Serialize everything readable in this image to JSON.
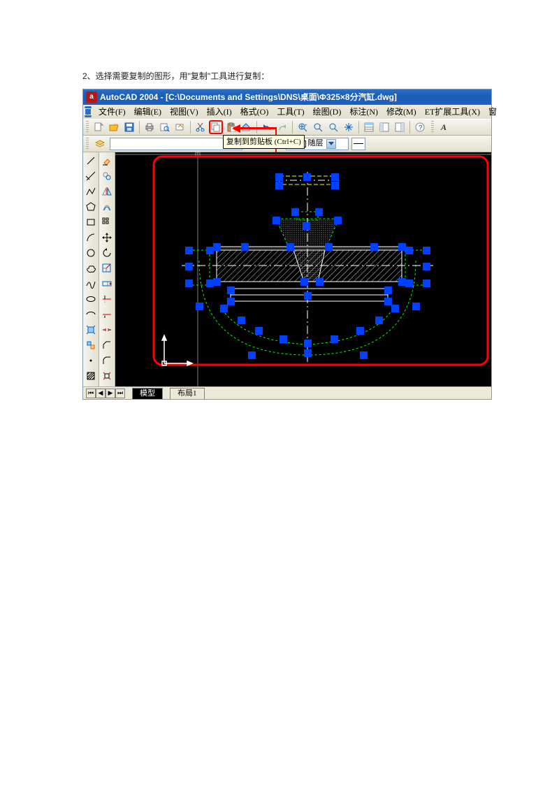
{
  "caption": "2、选择需要复制的图形，用\"复制\"工具进行复制：",
  "app_title": "AutoCAD 2004 - [C:\\Documents and Settings\\DNS\\桌面\\Φ325×8分汽缸.dwg]",
  "menus": {
    "file": "文件(F)",
    "edit": "编辑(E)",
    "view": "视图(V)",
    "insert": "插入(I)",
    "format": "格式(O)",
    "tools": "工具(T)",
    "draw": "绘图(D)",
    "dim": "标注(N)",
    "modify": "修改(M)",
    "et": "ET扩展工具(X)",
    "win": "窗"
  },
  "tooltip": {
    "label": "复制到剪贴板",
    "shortcut": "(Ctrl+C)"
  },
  "layer_labels": {
    "by_layer": "随层"
  },
  "tabs": {
    "model": "模型",
    "layout1": "布局1"
  }
}
